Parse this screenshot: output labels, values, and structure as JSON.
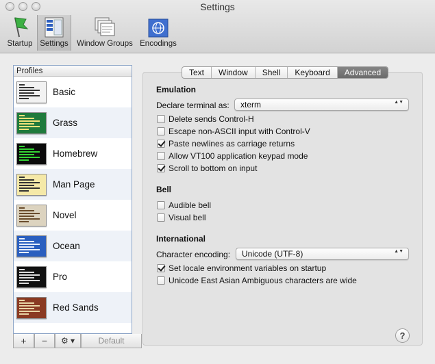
{
  "window": {
    "title": "Settings"
  },
  "toolbar": {
    "items": [
      {
        "label": "Startup",
        "icon": "startup-flag-icon"
      },
      {
        "label": "Settings",
        "icon": "settings-window-icon",
        "selected": true
      },
      {
        "label": "Window Groups",
        "icon": "window-groups-icon"
      },
      {
        "label": "Encodings",
        "icon": "encodings-globe-icon"
      }
    ]
  },
  "profiles": {
    "header": "Profiles",
    "items": [
      {
        "name": "Basic",
        "bg": "#f2f2f2",
        "fg": "#333333"
      },
      {
        "name": "Grass",
        "bg": "#1f7a3c",
        "fg": "#f3e27a"
      },
      {
        "name": "Homebrew",
        "bg": "#0b0b0b",
        "fg": "#35d435"
      },
      {
        "name": "Man Page",
        "bg": "#f5e9a8",
        "fg": "#333333"
      },
      {
        "name": "Novel",
        "bg": "#dcd3bf",
        "fg": "#6a4c2c"
      },
      {
        "name": "Ocean",
        "bg": "#2a5fbf",
        "fg": "#e6eeff"
      },
      {
        "name": "Pro",
        "bg": "#111111",
        "fg": "#dddddd"
      },
      {
        "name": "Red Sands",
        "bg": "#8a3a22",
        "fg": "#e9d6a6"
      }
    ],
    "buttons": {
      "add": "+",
      "remove": "−",
      "gear": "⚙ ▾",
      "default": "Default"
    }
  },
  "tabs": [
    {
      "label": "Text"
    },
    {
      "label": "Window"
    },
    {
      "label": "Shell"
    },
    {
      "label": "Keyboard"
    },
    {
      "label": "Advanced",
      "active": true
    }
  ],
  "emulation": {
    "title": "Emulation",
    "declare_label": "Declare terminal as:",
    "declare_value": "xterm",
    "options": [
      {
        "label": "Delete sends Control-H",
        "checked": false
      },
      {
        "label": "Escape non-ASCII input with Control-V",
        "checked": false
      },
      {
        "label": "Paste newlines as carriage returns",
        "checked": true
      },
      {
        "label": "Allow VT100 application keypad mode",
        "checked": false
      },
      {
        "label": "Scroll to bottom on input",
        "checked": true
      }
    ]
  },
  "bell": {
    "title": "Bell",
    "options": [
      {
        "label": "Audible bell",
        "checked": false
      },
      {
        "label": "Visual bell",
        "checked": false
      }
    ]
  },
  "international": {
    "title": "International",
    "encoding_label": "Character encoding:",
    "encoding_value": "Unicode (UTF-8)",
    "options": [
      {
        "label": "Set locale environment variables on startup",
        "checked": true
      },
      {
        "label": "Unicode East Asian Ambiguous characters are wide",
        "checked": false
      }
    ]
  },
  "help": {
    "label": "?"
  },
  "popup_arrows": "▲▼"
}
